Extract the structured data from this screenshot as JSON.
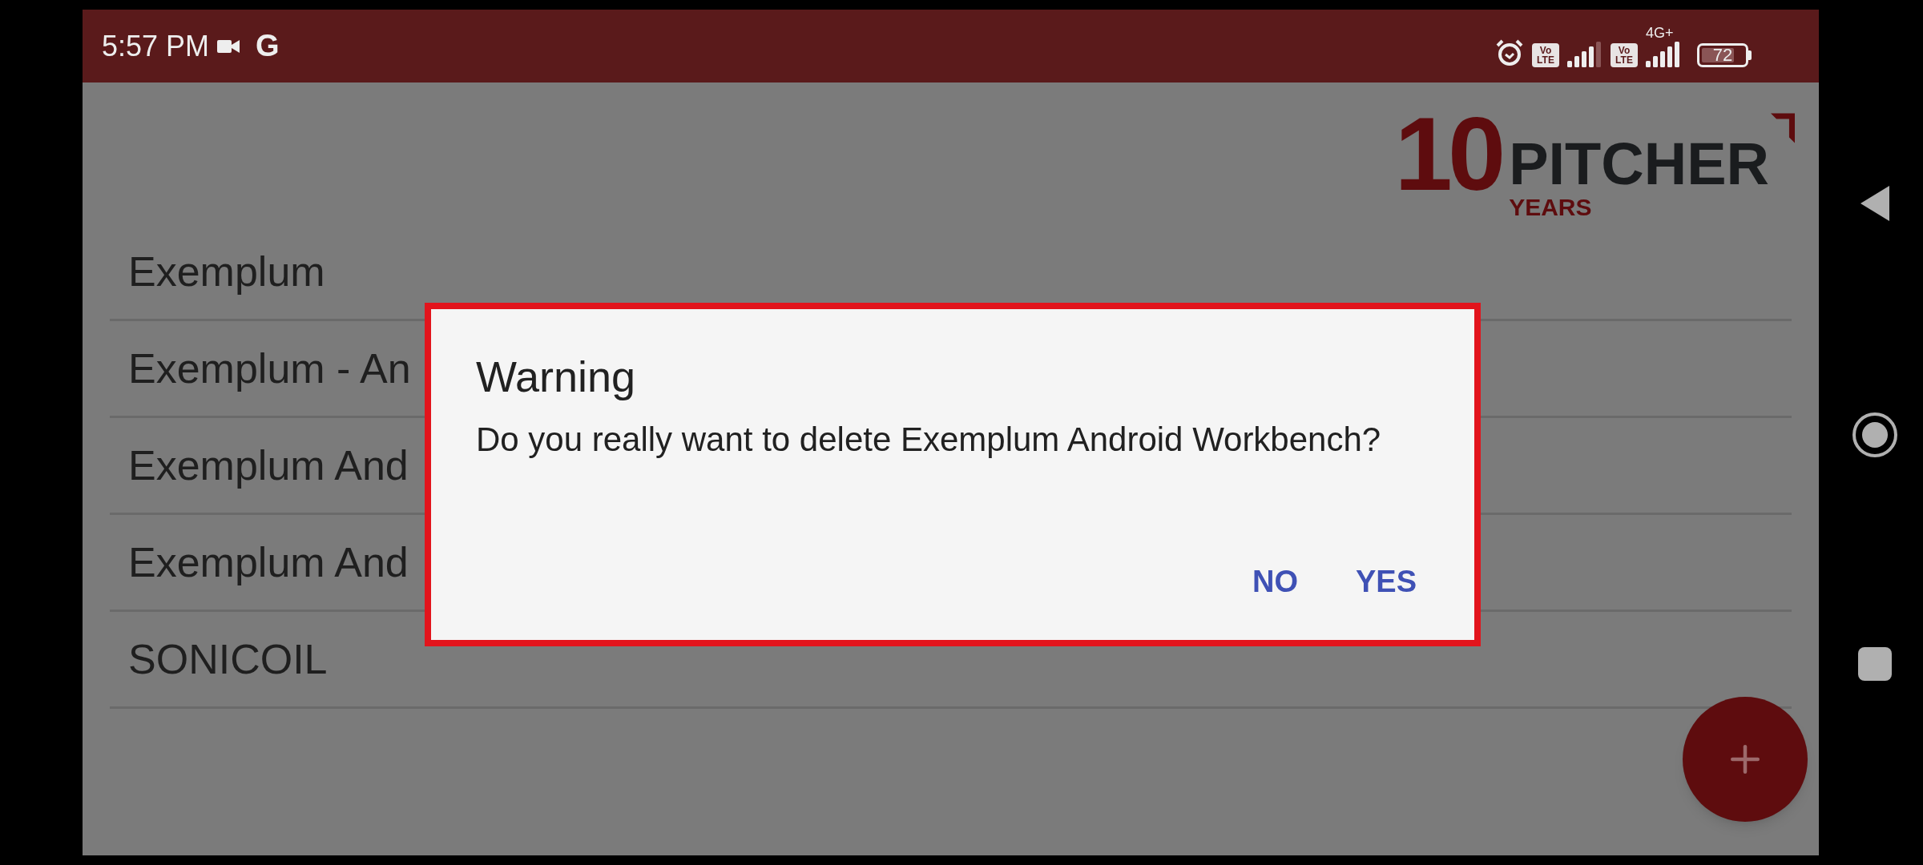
{
  "status_bar": {
    "time": "5:57 PM",
    "google_letter": "G",
    "volte_badges": [
      {
        "top": "Vo",
        "bottom": "LTE"
      },
      {
        "top": "Vo",
        "bottom": "LTE"
      }
    ],
    "network_type": "4G+",
    "battery": "72"
  },
  "logo": {
    "number": "10",
    "name": "PITCHER",
    "subtitle": "YEARS"
  },
  "list": [
    {
      "title": "Exemplum"
    },
    {
      "title": "Exemplum - An"
    },
    {
      "title": "Exemplum And"
    },
    {
      "title": "Exemplum And"
    },
    {
      "title": "SONICOIL"
    }
  ],
  "dialog": {
    "title": "Warning",
    "message": "Do you really want to delete Exemplum Android Workbench?",
    "buttons": [
      {
        "label": "NO"
      },
      {
        "label": "YES"
      }
    ]
  }
}
